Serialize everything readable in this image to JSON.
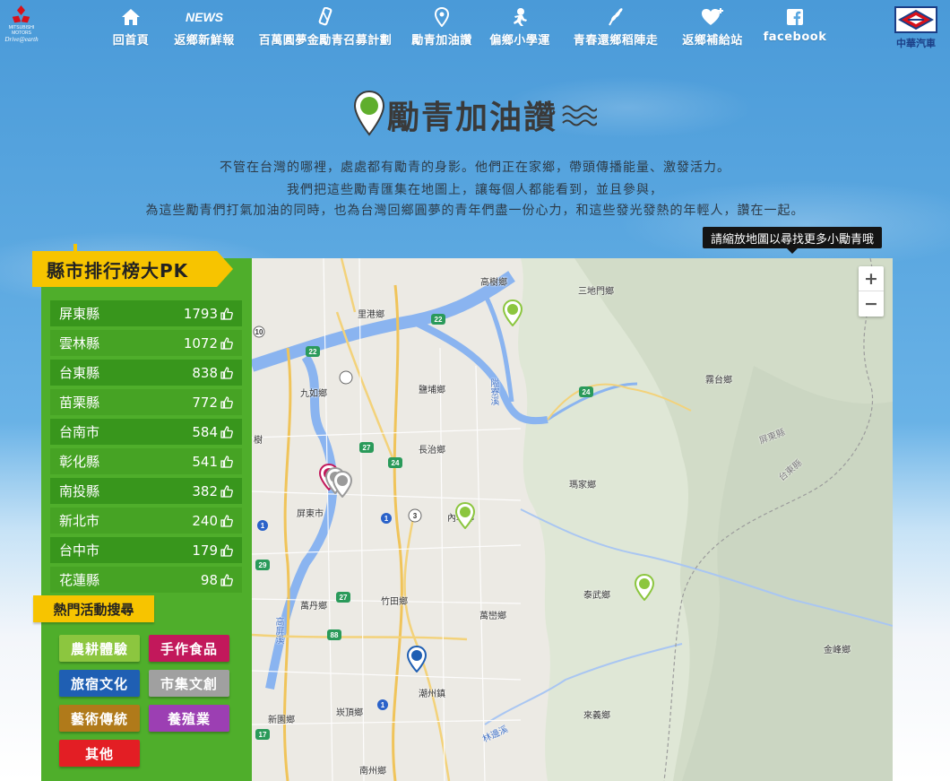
{
  "header": {
    "left_brand": {
      "name": "MITSUBISHI MOTORS",
      "tagline": "Drive@earth"
    },
    "right_brand": {
      "name": "中華汽車"
    },
    "nav": [
      {
        "label": "回首頁",
        "icon": "home-icon"
      },
      {
        "label": "返鄉新鮮報",
        "icon": "news-icon"
      },
      {
        "label": "百萬圓夢金勵青召募計劃",
        "icon": "pen-icon"
      },
      {
        "label": "勵青加油讚",
        "icon": "map-pin-icon"
      },
      {
        "label": "偏鄉小學運",
        "icon": "runner-icon"
      },
      {
        "label": "青春還鄉稻陣走",
        "icon": "rice-icon"
      },
      {
        "label": "返鄉補給站",
        "icon": "heart-plus-icon"
      },
      {
        "label": "facebook",
        "icon": "facebook-icon"
      }
    ],
    "news_glyph": "NEWS"
  },
  "hero": {
    "title": "勵青加油讚",
    "desc_line1": "不管在台灣的哪裡，處處都有勵青的身影。他們正在家鄉，帶頭傳播能量、激發活力。",
    "desc_line2": "我們把這些勵青匯集在地圖上，讓每個人都能看到，並且參與，",
    "desc_line3": "為這些勵青們打氣加油的同時，也為台灣回鄉圓夢的青年們盡一份心力，和這些發光發熱的年輕人，讚在一起。"
  },
  "ranking": {
    "title": "縣市排行榜大PK",
    "rows": [
      {
        "county": "屏東縣",
        "count": "1793"
      },
      {
        "county": "雲林縣",
        "count": "1072"
      },
      {
        "county": "台東縣",
        "count": "838"
      },
      {
        "county": "苗栗縣",
        "count": "772"
      },
      {
        "county": "台南市",
        "count": "584"
      },
      {
        "county": "彰化縣",
        "count": "541"
      },
      {
        "county": "南投縣",
        "count": "382"
      },
      {
        "county": "新北市",
        "count": "240"
      },
      {
        "county": "台中市",
        "count": "179"
      },
      {
        "county": "花蓮縣",
        "count": "98"
      }
    ]
  },
  "hot": {
    "title": "熱門活動搜尋",
    "tags": [
      {
        "label": "農耕體驗",
        "color": "#8cc63f"
      },
      {
        "label": "手作食品",
        "color": "#c2185b"
      },
      {
        "label": "旅宿文化",
        "color": "#1f5fb3"
      },
      {
        "label": "市集文創",
        "color": "#a0a0a0"
      },
      {
        "label": "藝術傳統",
        "color": "#b07a1a"
      },
      {
        "label": "養殖業",
        "color": "#9c3fb3"
      },
      {
        "label": "其他",
        "color": "#e31e24"
      }
    ]
  },
  "map": {
    "tooltip": "請縮放地圖以尋找更多小勵青哦",
    "zoom_in": "+",
    "zoom_out": "−",
    "labels": {
      "gaoshu": "高樹鄉",
      "sandimen": "三地門鄉",
      "ligang": "里港鄉",
      "wutai": "霧台鄉",
      "jiuru": "九如鄉",
      "yanpu": "鹽埔鄉",
      "changzhi": "長治鄉",
      "pingtung_county": "屏東縣",
      "taitung_county": "台東縣",
      "majia": "瑪家鄉",
      "pingtung_city": "屏東市",
      "neipu": "內埔鄉",
      "taiwu": "泰武鄉",
      "wandan": "萬丹鄉",
      "zhutian": "竹田鄉",
      "wanluan": "萬巒鄉",
      "jinfeng": "金峰鄉",
      "chaozhou": "潮州鎮",
      "xinyuan": "新園鄉",
      "kanding": "崁頂鄉",
      "laiyi": "來義鄉",
      "nanzhou": "南州鄉",
      "shuzi": "樹",
      "river": "高屏溪",
      "linbian_river": "林邊溪",
      "ailiao_river": "隘寮溪"
    },
    "roads": [
      "22",
      "22",
      "22",
      "24",
      "27",
      "24",
      "1",
      "3",
      "27",
      "29",
      "1",
      "3",
      "88",
      "1",
      "17",
      "17",
      "10"
    ]
  }
}
